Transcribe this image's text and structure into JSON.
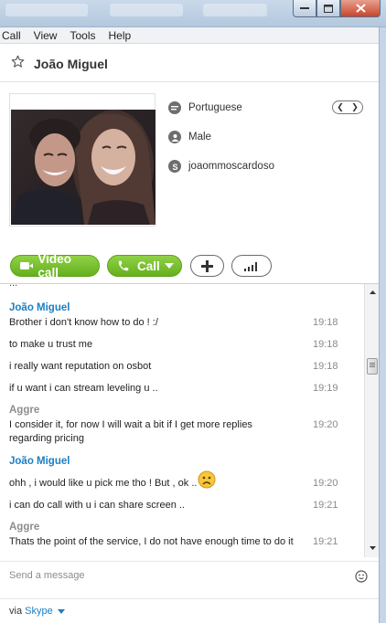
{
  "menu": [
    "Call",
    "View",
    "Tools",
    "Help"
  ],
  "contact": {
    "name": "João Miguel"
  },
  "profile": {
    "language": "Portuguese",
    "gender": "Male",
    "skype_name": "joaommoscardoso"
  },
  "actions": {
    "video_call_label": "Video call",
    "call_label": "Call"
  },
  "chat": {
    "partial_top": "...",
    "entries": [
      {
        "kind": "sender",
        "who": "me",
        "text": "João Miguel"
      },
      {
        "kind": "msg",
        "text": "Brother i don't know how to do ! :/",
        "time": "19:18"
      },
      {
        "kind": "msg",
        "text": "to make u trust me",
        "time": "19:18"
      },
      {
        "kind": "msg",
        "text": "i really want reputation on osbot",
        "time": "19:18"
      },
      {
        "kind": "msg",
        "text": "if u want i can stream leveling u ..",
        "time": "19:19"
      },
      {
        "kind": "sender",
        "who": "other",
        "text": "Aggre"
      },
      {
        "kind": "msg",
        "text": "I consider it, for now I will wait a bit if I get more replies",
        "time": "19:20"
      },
      {
        "kind": "msg_cont",
        "text": "regarding pricing"
      },
      {
        "kind": "sender",
        "who": "me",
        "text": "João Miguel"
      },
      {
        "kind": "msg",
        "text": "ohh , i would like u pick me tho ! But , ok ..",
        "time": "19:20",
        "emoji": "sad-face-icon"
      },
      {
        "kind": "msg",
        "text": "i can do call with u i can share screen ..",
        "time": "19:21"
      },
      {
        "kind": "sender",
        "who": "other",
        "text": "Aggre"
      },
      {
        "kind": "msg",
        "text": "Thats the point of the service, I do not have enough time to do it",
        "time": "19:21"
      }
    ]
  },
  "composer": {
    "placeholder": "Send a message"
  },
  "footer": {
    "via_prefix": "via",
    "via_link": "Skype"
  },
  "colors": {
    "accent_green": "#6ab523",
    "skype_blue": "#1a7fc4",
    "sender_gray": "#8c8c8c"
  }
}
